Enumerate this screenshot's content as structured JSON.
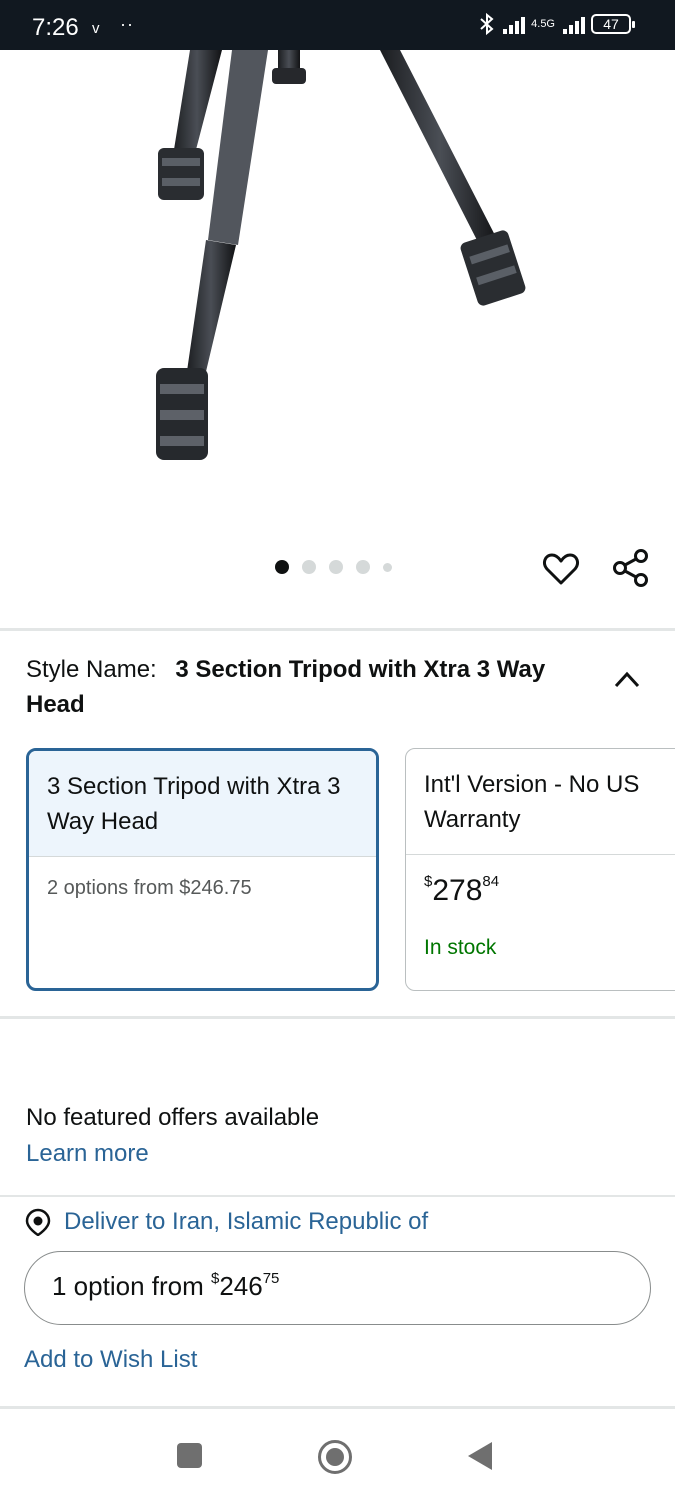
{
  "status_bar": {
    "time": "7:26",
    "vm_icon": "v",
    "dots": "··",
    "network_label": "4.5G",
    "battery": "47"
  },
  "product_image": {
    "description_icon": "tripod-image"
  },
  "carousel": {
    "count": 5,
    "active_index": 0
  },
  "style": {
    "label": "Style Name:",
    "value": "3 Section Tripod with Xtra 3 Way Head"
  },
  "options": [
    {
      "title": "3 Section Tripod with Xtra 3 Way Head",
      "subtitle": "2 options from $246.75",
      "selected": true
    },
    {
      "title": "Int'l Version - No US Warranty",
      "price_symbol": "$",
      "price_whole": "278",
      "price_fraction": "84",
      "availability": "In stock",
      "selected": false
    }
  ],
  "offers": {
    "no_offers": "No featured offers available",
    "learn_more": "Learn more"
  },
  "delivery": {
    "text": "Deliver to Iran, Islamic Republic of"
  },
  "option_button": {
    "prefix": "1 option from ",
    "price_symbol": "$",
    "price_whole": "246",
    "price_fraction": "75"
  },
  "wishlist": {
    "label": "Add to Wish List"
  },
  "colors": {
    "link": "#2a6496",
    "in_stock": "#007600",
    "selected_border": "#2a6496",
    "status_bar": "#111820"
  }
}
